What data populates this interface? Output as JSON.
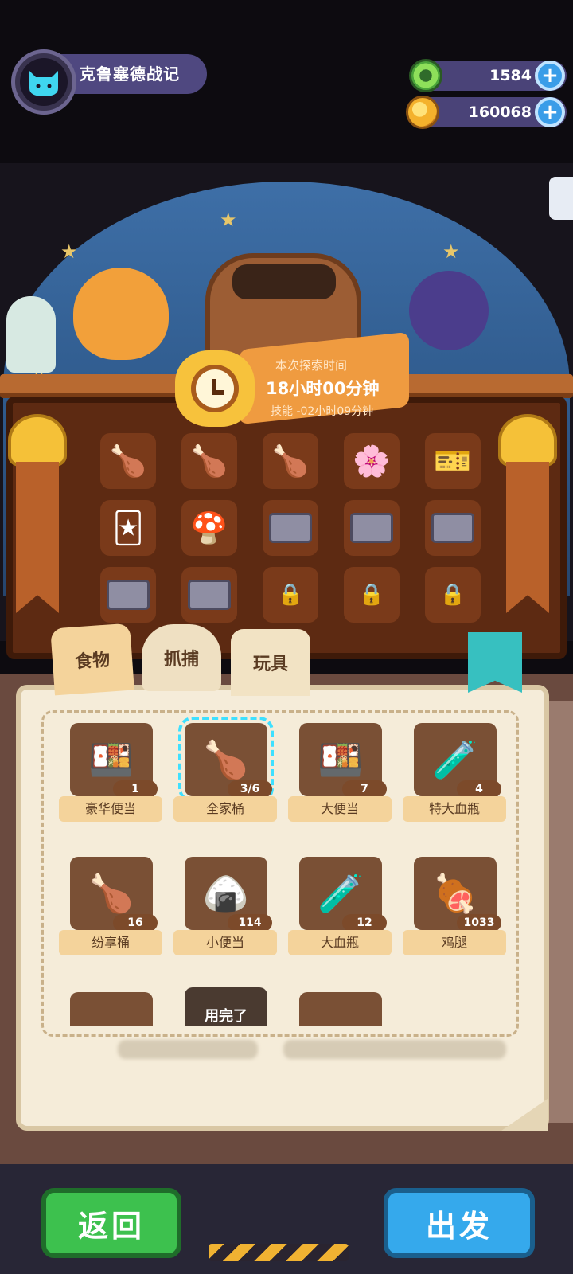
{
  "header": {
    "title": "克鲁塞德战记",
    "avatar_icon": "cat-avatar-icon"
  },
  "resources": [
    {
      "icon": "green-gem-icon",
      "value": "1584"
    },
    {
      "icon": "gold-planet-icon",
      "value": "160068"
    }
  ],
  "expedition": {
    "label": "本次探索时间",
    "time": "18小时00分钟",
    "skill": "技能 -02小时09分钟"
  },
  "equipped_slots": [
    {
      "icon": "chicken-bucket-icon",
      "glyph": "🍗"
    },
    {
      "icon": "chicken-bucket-icon",
      "glyph": "🍗"
    },
    {
      "icon": "chicken-bucket-icon",
      "glyph": "🍗"
    },
    {
      "icon": "flower-icon",
      "glyph": "🌸"
    },
    {
      "icon": "ticket-icon",
      "glyph": "🎫"
    },
    {
      "icon": "character-card-icon",
      "glyph": "🃏"
    },
    {
      "icon": "mushroom-icon",
      "glyph": "🍄"
    },
    {
      "icon": "crate-icon",
      "glyph": ""
    },
    {
      "icon": "crate-icon",
      "glyph": ""
    },
    {
      "icon": "crate-icon",
      "glyph": ""
    },
    {
      "icon": "crate-icon",
      "glyph": ""
    },
    {
      "icon": "crate-icon",
      "glyph": ""
    },
    {
      "icon": "lock-icon",
      "glyph": "🔒"
    },
    {
      "icon": "lock-icon",
      "glyph": "🔒"
    },
    {
      "icon": "lock-icon",
      "glyph": "🔒"
    }
  ],
  "tabs": [
    {
      "label": "食物"
    },
    {
      "label": "抓捕"
    },
    {
      "label": "玩具"
    }
  ],
  "items": [
    {
      "name": "豪华便当",
      "count": "1",
      "glyph": "🍱"
    },
    {
      "name": "全家桶",
      "count": "3/6",
      "glyph": "🍗"
    },
    {
      "name": "大便当",
      "count": "7",
      "glyph": "🍱"
    },
    {
      "name": "特大血瓶",
      "count": "4",
      "glyph": "🧪"
    },
    {
      "name": "纷享桶",
      "count": "16",
      "glyph": "🍗"
    },
    {
      "name": "小便当",
      "count": "114",
      "glyph": "🍙"
    },
    {
      "name": "大血瓶",
      "count": "12",
      "glyph": "🧪"
    },
    {
      "name": "鸡腿",
      "count": "1033",
      "glyph": "🍖"
    }
  ],
  "partial_row": {
    "used_label": "用完了"
  },
  "buttons": {
    "back": "返回",
    "go": "出发"
  },
  "colors": {
    "accent_green": "#3dc14e",
    "accent_blue": "#35a9ec",
    "selection": "#3ee0ff"
  }
}
